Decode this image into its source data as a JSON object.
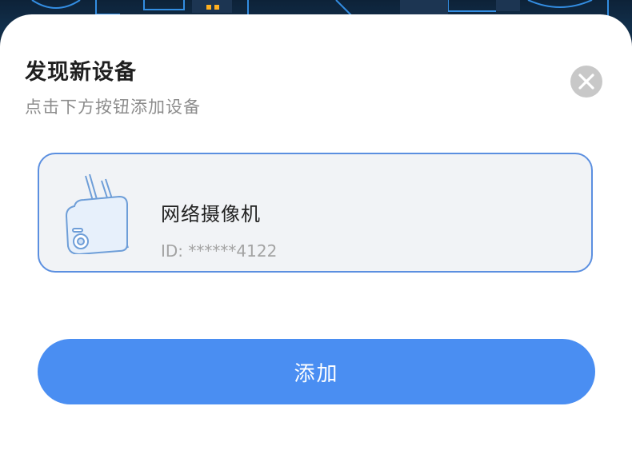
{
  "dialog": {
    "title": "发现新设备",
    "subtitle": "点击下方按钮添加设备",
    "close_icon": "close-icon"
  },
  "device": {
    "name": "网络摄像机",
    "id_label": "ID: ",
    "id_value": "******4122",
    "icon": "security-camera-icon"
  },
  "actions": {
    "add_label": "添加"
  },
  "colors": {
    "accent": "#4a8ef2",
    "card_border": "#5b8fe0",
    "card_background": "#f1f3f6",
    "close_background": "#c8c8c8"
  }
}
